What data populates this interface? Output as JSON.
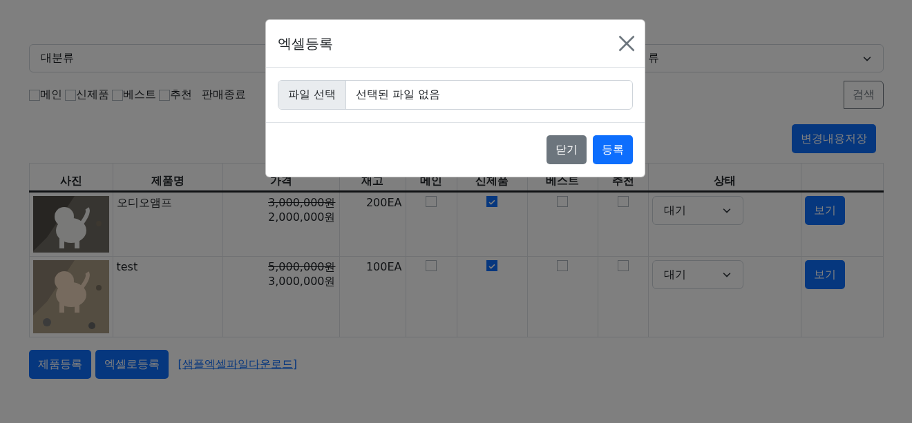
{
  "filters": {
    "selects": [
      "대분류",
      "류"
    ],
    "flags": [
      {
        "label": "메인",
        "checked": false
      },
      {
        "label": "신제품",
        "checked": false
      },
      {
        "label": "베스트",
        "checked": false
      },
      {
        "label": "추천",
        "checked": false
      }
    ],
    "discontinued_label": "판매종료",
    "search_button": "검색"
  },
  "save_button": "변경내용저장",
  "table": {
    "columns": [
      "사진",
      "제품명",
      "가격",
      "재고",
      "메인",
      "신제품",
      "베스트",
      "추천",
      "상태"
    ],
    "rows": [
      {
        "kind": "picture",
        "name": "오디오앰프",
        "original_price": "3,000,000원",
        "price": "2,000,000원",
        "stock": "200EA",
        "main": false,
        "new": true,
        "best": false,
        "recommend": false,
        "status": "대기",
        "view_button": "보기"
      },
      {
        "kind": "picture",
        "name": "test",
        "original_price": "5,000,000원",
        "price": "3,000,000원",
        "stock": "100EA",
        "main": false,
        "new": true,
        "best": false,
        "recommend": false,
        "status": "대기",
        "view_button": "보기"
      }
    ]
  },
  "bottom": {
    "buttons": [
      "제품등록",
      "엑셀로등록"
    ],
    "link": "[샘플엑셀파일다운로드]"
  },
  "modal": {
    "title": "엑셀등록",
    "file_button": "파일 선택",
    "file_status": "선택된 파일 없음",
    "buttons": [
      {
        "label": "닫기",
        "kind": "secondary"
      },
      {
        "label": "등록",
        "kind": "primary"
      }
    ]
  }
}
